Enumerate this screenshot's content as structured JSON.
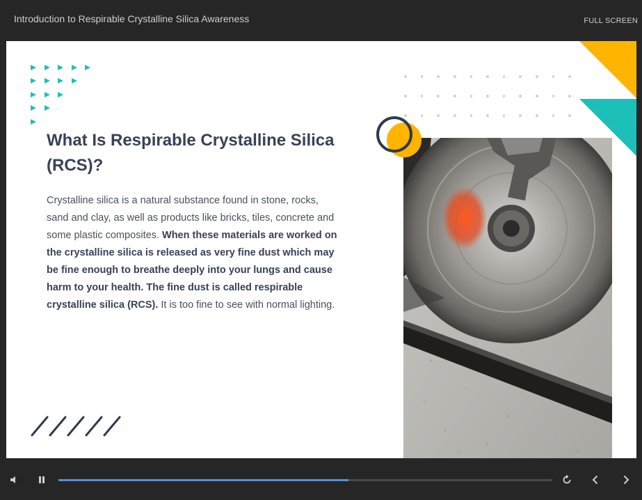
{
  "header": {
    "course_title": "Introduction to Respirable Crystalline Silica Awareness",
    "fullscreen_label": "FULL SCREEN"
  },
  "slide": {
    "heading": "What Is Respirable Crystalline Silica (RCS)?",
    "paragraph": {
      "part1": "Crystalline silica is a natural substance found in stone, rocks, sand and clay, as well as products like bricks, tiles, concrete and some plastic composites. ",
      "part2_bold": "When these materials are worked on the crystalline silica is released as very fine dust which may be fine enough to breathe deeply into your lungs and cause harm to your health. The fine dust is called respirable crystalline silica (RCS).",
      "part3": " It is too fine to see with normal lighting."
    }
  },
  "player": {
    "progress_fraction": 0.587,
    "icons": [
      "volume-icon",
      "pause-icon",
      "replay-icon",
      "previous-icon",
      "next-icon"
    ]
  },
  "colors": {
    "teal": "#1cc0b9",
    "yellow": "#ffb400",
    "navy": "#3a4156",
    "progress": "#5b8fd6"
  }
}
